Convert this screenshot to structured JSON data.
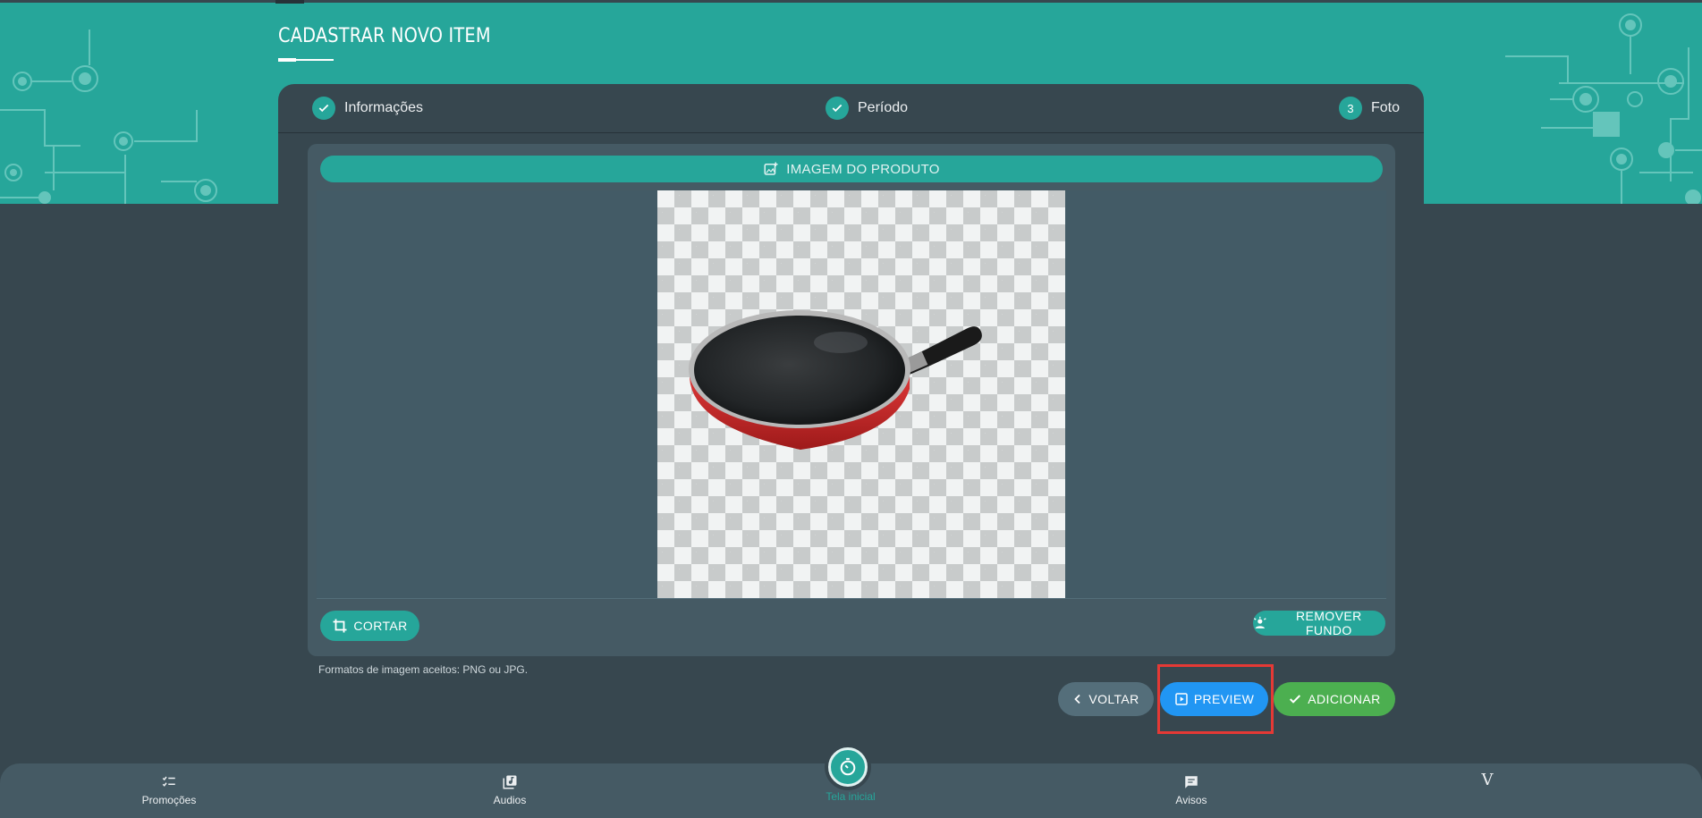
{
  "page": {
    "title": "CADASTRAR NOVO ITEM"
  },
  "steps": [
    {
      "label": "Informações",
      "state": "done"
    },
    {
      "label": "Período",
      "state": "done"
    },
    {
      "label": "Foto",
      "number": "3",
      "state": "active"
    }
  ],
  "panel": {
    "header": "IMAGEM DO PRODUTO",
    "crop_label": "CORTAR",
    "remove_bg_label": "REMOVER FUNDO",
    "hint": "Formatos de imagem aceitos: PNG ou JPG."
  },
  "actions": {
    "back_label": "VOLTAR",
    "preview_label": "PREVIEW",
    "add_label": "ADICIONAR"
  },
  "nav": {
    "items": [
      {
        "label": "Promoções",
        "icon": "checklist-icon"
      },
      {
        "label": "Audios",
        "icon": "music-library-icon"
      },
      {
        "label": "Tela inicial",
        "icon": "timer-icon"
      },
      {
        "label": "Avisos",
        "icon": "message-icon"
      },
      {
        "label": "V",
        "icon": "brand-logo"
      }
    ]
  },
  "colors": {
    "teal": "#26a69a",
    "background": "#37474f",
    "panel": "#455a64",
    "preview": "#2196f3",
    "add": "#4caf50",
    "back": "#546e7a",
    "highlight": "#e53935"
  }
}
